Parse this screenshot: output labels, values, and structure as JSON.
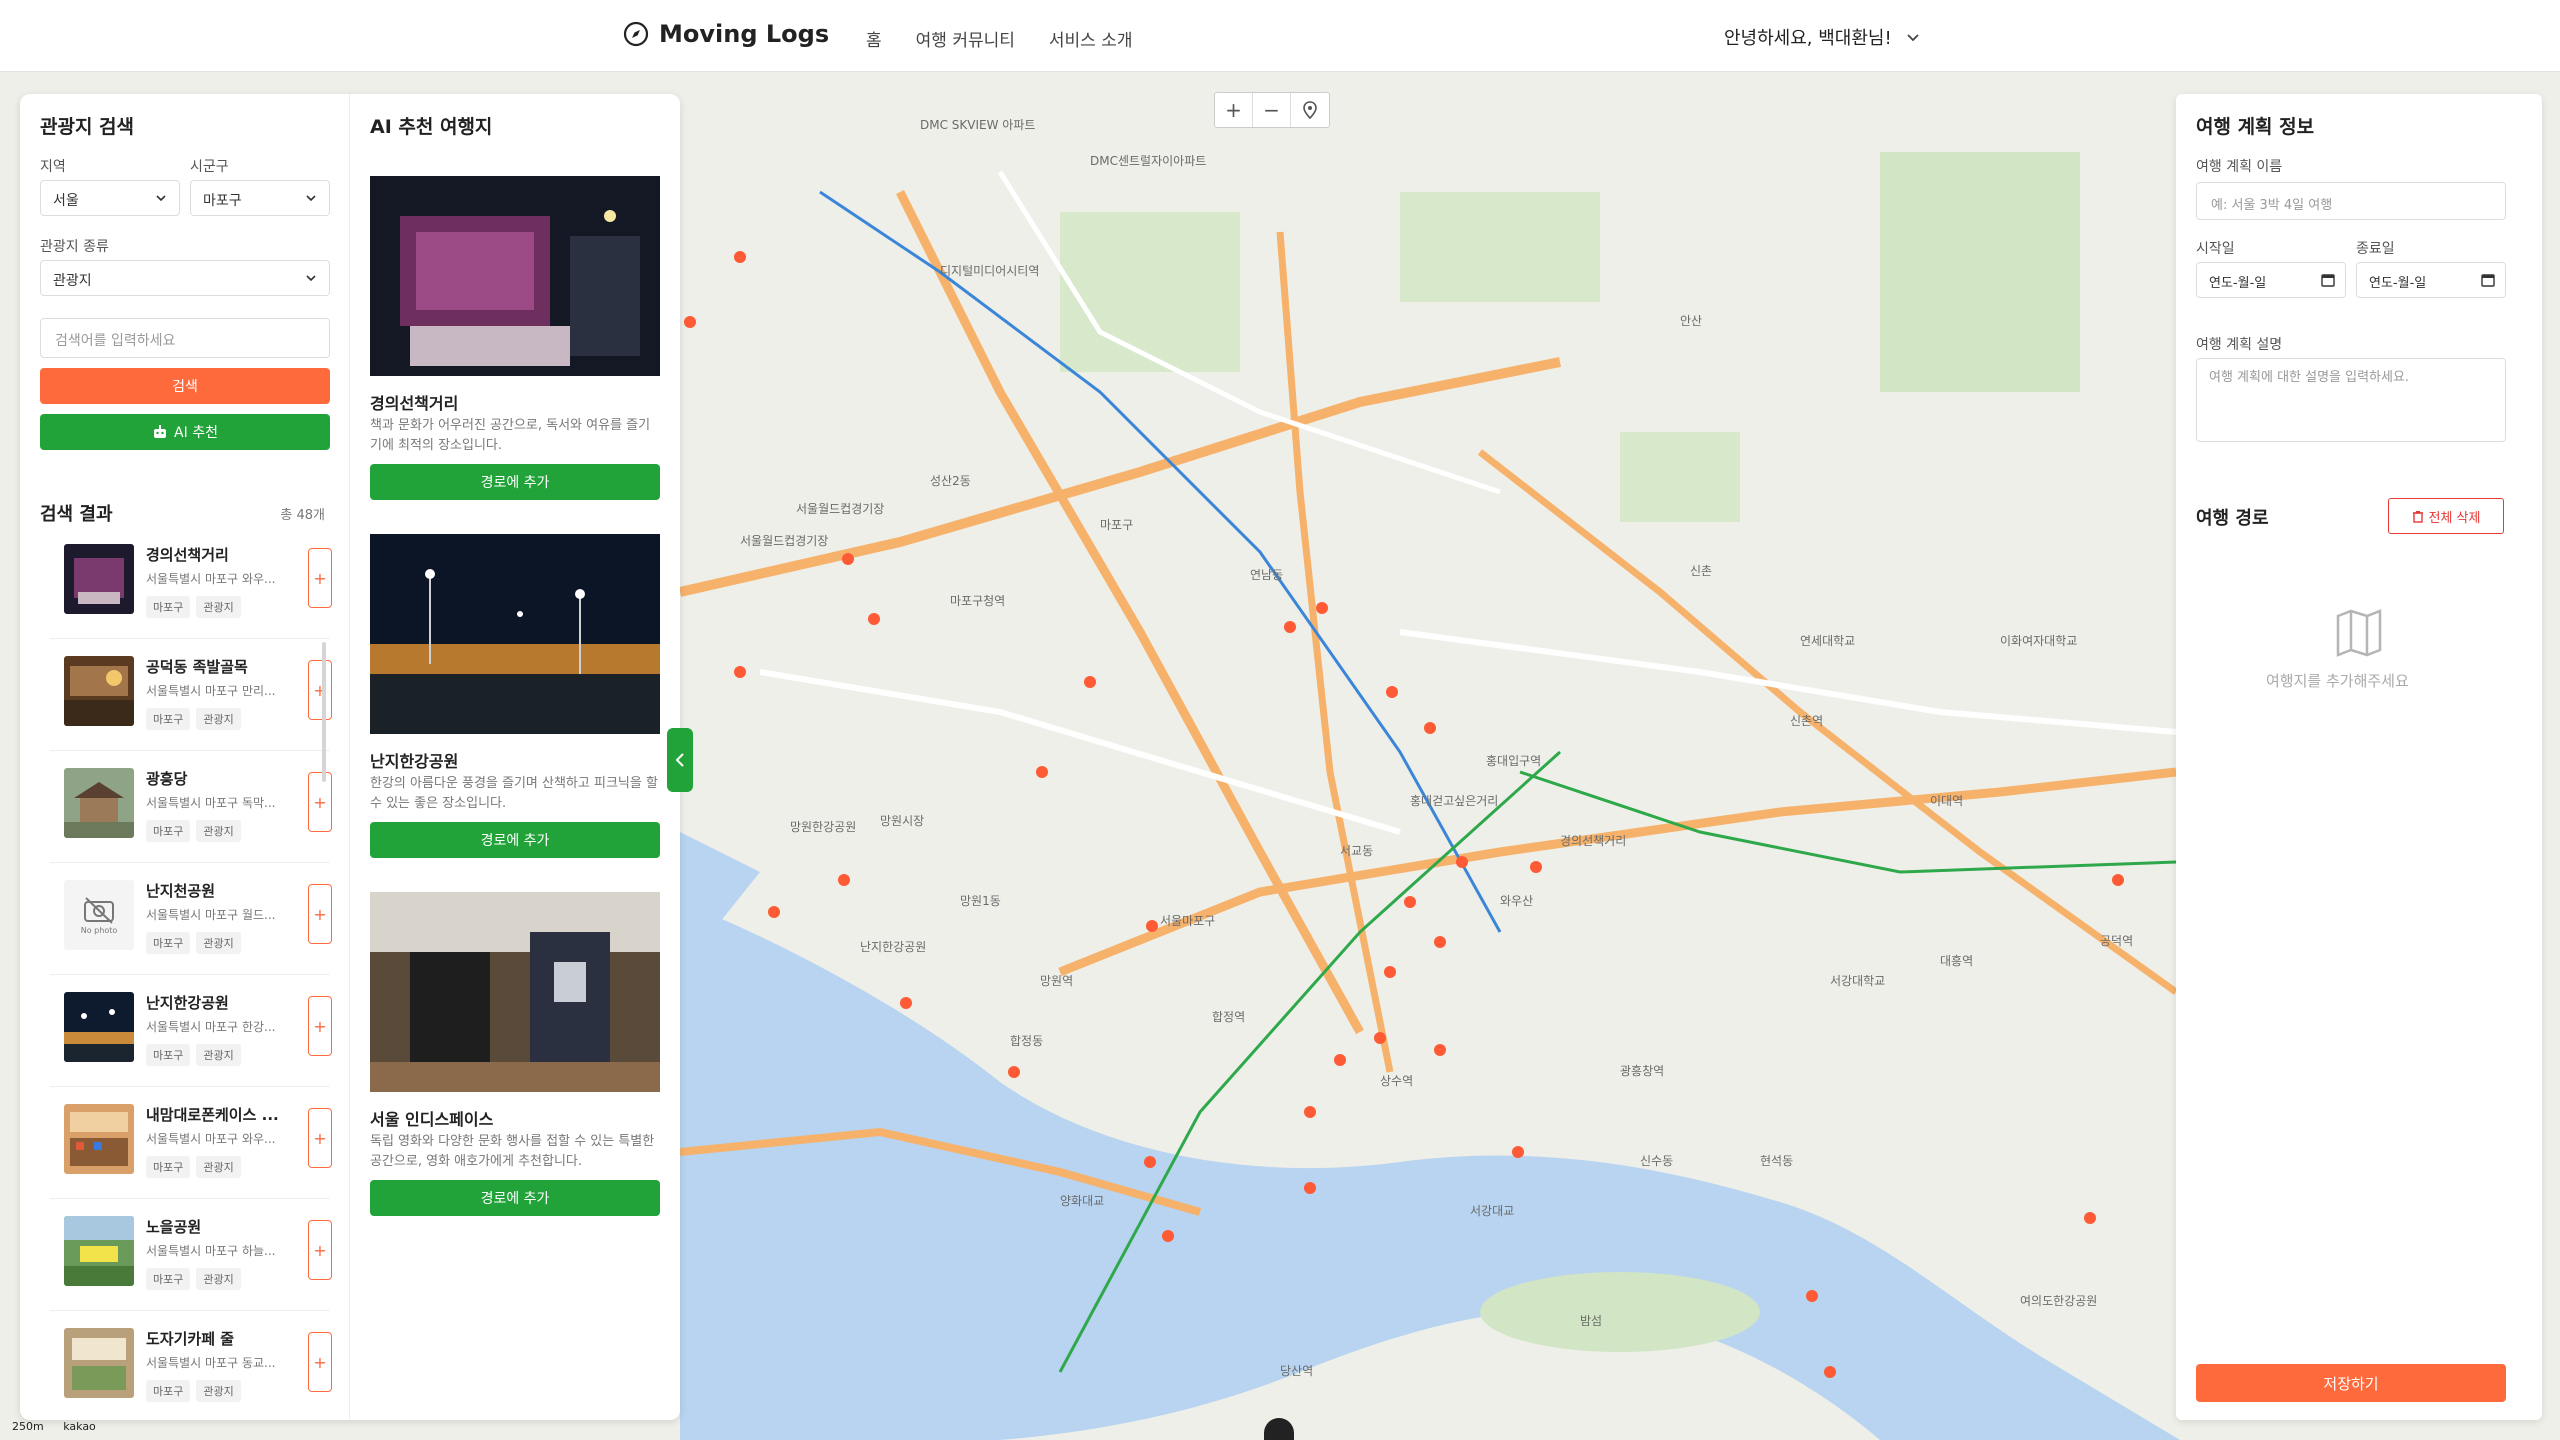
{
  "header": {
    "logo": "Moving Logs",
    "nav": [
      "홈",
      "여행 커뮤니티",
      "서비스 소개"
    ],
    "greeting": "안녕하세요, 백대환님!"
  },
  "search_panel": {
    "title": "관광지 검색",
    "region_label": "지역",
    "region_value": "서울",
    "district_label": "시군구",
    "district_value": "마포구",
    "type_label": "관광지 종류",
    "type_value": "관광지",
    "search_placeholder": "검색어를 입력하세요",
    "search_button": "검색",
    "ai_button": "AI 추천",
    "results_title": "검색 결과",
    "results_count": "총 48개",
    "results": [
      {
        "name": "경의선책거리",
        "addr": "서울특별시 마포구 와우...",
        "tags": [
          "마포구",
          "관광지"
        ],
        "image": "photo-bookstreet"
      },
      {
        "name": "공덕동 족발골목",
        "addr": "서울특별시 마포구 만리...",
        "tags": [
          "마포구",
          "관광지"
        ],
        "image": "photo-jokbal"
      },
      {
        "name": "광흥당",
        "addr": "서울특별시 마포구 독막...",
        "tags": [
          "마포구",
          "관광지"
        ],
        "image": "photo-shrine"
      },
      {
        "name": "난지천공원",
        "addr": "서울특별시 마포구 월드...",
        "tags": [
          "마포구",
          "관광지"
        ],
        "image": "no-photo"
      },
      {
        "name": "난지한강공원",
        "addr": "서울특별시 마포구 한강...",
        "tags": [
          "마포구",
          "관광지"
        ],
        "image": "photo-night-park"
      },
      {
        "name": "내맘대로폰케이스 ...",
        "addr": "서울특별시 마포구 와우...",
        "tags": [
          "마포구",
          "관광지"
        ],
        "image": "photo-shop"
      },
      {
        "name": "노을공원",
        "addr": "서울특별시 마포구 하늘...",
        "tags": [
          "마포구",
          "관광지"
        ],
        "image": "photo-sunset-park"
      },
      {
        "name": "도자기카페 줄",
        "addr": "서울특별시 마포구 동교...",
        "tags": [
          "마포구",
          "관광지"
        ],
        "image": "photo-cafe"
      }
    ],
    "no_photo_text": "No photo"
  },
  "ai_panel": {
    "title": "AI 추천 여행지",
    "cards": [
      {
        "name": "경의선책거리",
        "desc": "책과 문화가 어우러진 공간으로, 독서와 여유를 즐기기에 최적의 장소입니다.",
        "button": "경로에 추가"
      },
      {
        "name": "난지한강공원",
        "desc": "한강의 아름다운 풍경을 즐기며 산책하고 피크닉을 할 수 있는 좋은 장소입니다.",
        "button": "경로에 추가"
      },
      {
        "name": "서울 인디스페이스",
        "desc": "독립 영화와 다양한 문화 행사를 접할 수 있는 특별한 공간으로, 영화 애호가에게 추천합니다.",
        "button": "경로에 추가"
      }
    ]
  },
  "plan_panel": {
    "title": "여행 계획 정보",
    "name_label": "여행 계획 이름",
    "name_placeholder": "예: 서울 3박 4일 여행",
    "start_label": "시작일",
    "end_label": "종료일",
    "date_placeholder": "연도-월-일",
    "desc_label": "여행 계획 설명",
    "desc_placeholder": "여행 계획에 대한 설명을 입력하세요.",
    "route_title": "여행 경로",
    "delete_all": "전체 삭제",
    "empty_route": "여행지를 추가해주세요",
    "save_button": "저장하기"
  },
  "map": {
    "labels": [
      "DMC SKVIEW 아파트",
      "DMC센트럴자이아파트",
      "디지털미디어시티역",
      "성산2동",
      "마포구청역",
      "망원한강공원",
      "연남동",
      "홍대입구역",
      "신촌역",
      "이대역",
      "서강대학교",
      "합정역",
      "상수역",
      "광흥창역",
      "마포구",
      "서울월드컵경기장",
      "망원역",
      "난지한강공원",
      "서교동",
      "와우산",
      "신촌",
      "대흥역",
      "공덕역",
      "여의도한강공원",
      "밤섬",
      "서강대교",
      "양화대교",
      "당산역",
      "이화여자대학교",
      "연세대학교",
      "서울월드컵경기장",
      "안산",
      "망원시장",
      "합정동",
      "망원1동",
      "서울마포구",
      "경의선책거리",
      "홍대걷고싶은거리",
      "신수동",
      "현석동"
    ],
    "scale_text": "250m",
    "brand": "kakao",
    "colors": {
      "road_major": "#f6b26b",
      "road_minor": "#ffffff",
      "river": "#b8d4f0",
      "park": "#cfe6c2",
      "marker": "#ff5a36",
      "subway_green": "#2ea84a",
      "subway_blue": "#3b86d8"
    }
  },
  "colors": {
    "accent_orange": "#ff6a3d",
    "accent_green": "#22a33a",
    "danger_red": "#e53935"
  }
}
